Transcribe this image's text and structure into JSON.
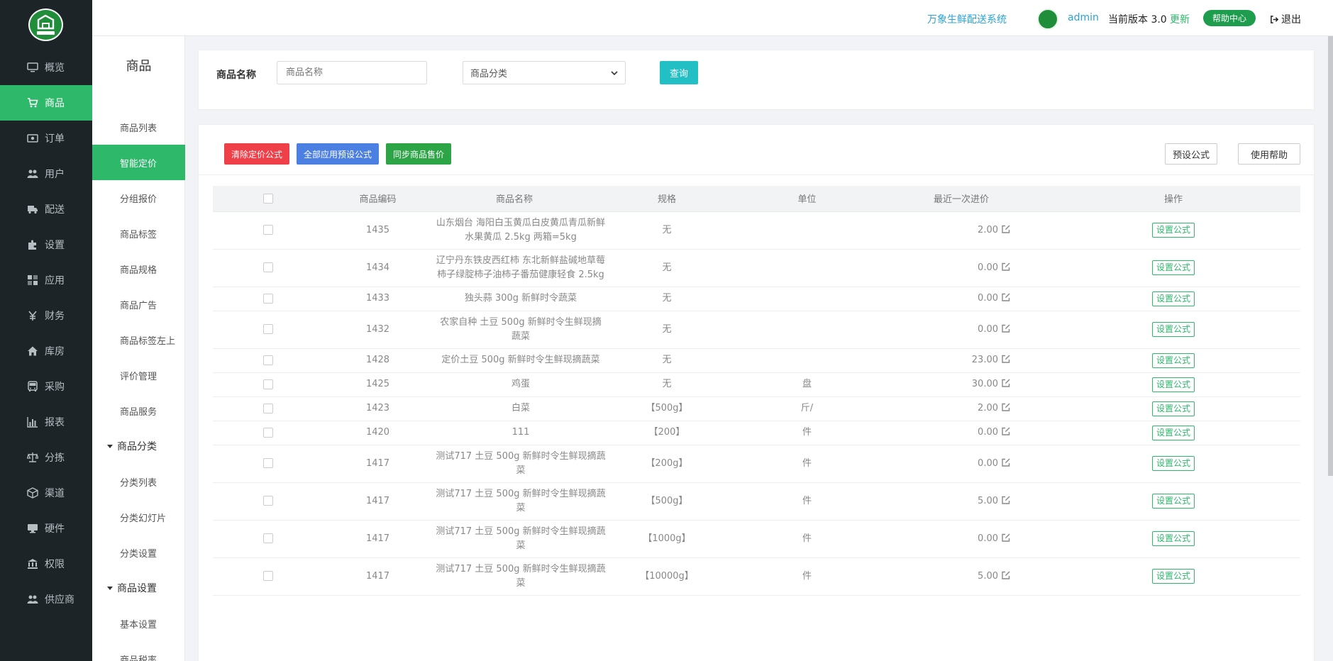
{
  "sidebar": {
    "items": [
      {
        "label": "概览",
        "icon": "monitor-icon"
      },
      {
        "label": "商品",
        "icon": "cart-icon",
        "active": true
      },
      {
        "label": "订单",
        "icon": "money-icon"
      },
      {
        "label": "用户",
        "icon": "users-icon"
      },
      {
        "label": "配送",
        "icon": "truck-icon"
      },
      {
        "label": "设置",
        "icon": "puzzle-icon"
      },
      {
        "label": "应用",
        "icon": "apps-icon"
      },
      {
        "label": "财务",
        "icon": "yen-icon"
      },
      {
        "label": "库房",
        "icon": "home-icon"
      },
      {
        "label": "采购",
        "icon": "bus-icon"
      },
      {
        "label": "报表",
        "icon": "bar-chart-icon"
      },
      {
        "label": "分拣",
        "icon": "scale-icon"
      },
      {
        "label": "渠道",
        "icon": "cube-icon"
      },
      {
        "label": "硬件",
        "icon": "desktop-icon"
      },
      {
        "label": "权限",
        "icon": "bank-icon"
      },
      {
        "label": "供应商",
        "icon": "users-icon"
      }
    ]
  },
  "topbar": {
    "system_name": "万象生鲜配送系统",
    "user": "admin",
    "version_label": "当前版本",
    "version": "3.0",
    "update_label": "更新",
    "help_label": "帮助中心",
    "logout_label": "退出"
  },
  "subnav": {
    "title": "商品",
    "items": [
      {
        "label": "商品列表",
        "type": "item"
      },
      {
        "label": "智能定价",
        "type": "item",
        "active": true
      },
      {
        "label": "分组报价",
        "type": "item"
      },
      {
        "label": "商品标签",
        "type": "item"
      },
      {
        "label": "商品规格",
        "type": "item"
      },
      {
        "label": "商品广告",
        "type": "item"
      },
      {
        "label": "商品标签左上",
        "type": "item"
      },
      {
        "label": "评价管理",
        "type": "item"
      },
      {
        "label": "商品服务",
        "type": "item"
      },
      {
        "label": "商品分类",
        "type": "group"
      },
      {
        "label": "分类列表",
        "type": "item"
      },
      {
        "label": "分类幻灯片",
        "type": "item"
      },
      {
        "label": "分类设置",
        "type": "item"
      },
      {
        "label": "商品设置",
        "type": "group"
      },
      {
        "label": "基本设置",
        "type": "item"
      },
      {
        "label": "商品税率",
        "type": "item"
      }
    ]
  },
  "search": {
    "name_label": "商品名称",
    "name_placeholder": "商品名称",
    "category_placeholder": "商品分类",
    "query_label": "查询"
  },
  "actions": {
    "clear_formula": "清除定价公式",
    "apply_all_preset": "全部应用预设公式",
    "sync_price": "同步商品售价",
    "preset_formula": "预设公式",
    "usage_help": "使用帮助"
  },
  "table": {
    "columns": [
      "商品编码",
      "商品名称",
      "规格",
      "单位",
      "最近一次进价",
      "操作"
    ],
    "action_label": "设置公式",
    "rows": [
      {
        "code": "1435",
        "name": "山东烟台 海阳白玉黄瓜白皮黄瓜青瓜新鲜水果黄瓜 2.5kg 两箱=5kg",
        "spec": "无",
        "unit": "",
        "price": "2.00"
      },
      {
        "code": "1434",
        "name": "辽宁丹东铁皮西红柿 东北新鲜盐碱地草莓柿子绿腚柿子油柿子番茄健康轻食 2.5kg",
        "spec": "无",
        "unit": "",
        "price": "0.00"
      },
      {
        "code": "1433",
        "name": "独头蒜 300g 新鲜时令蔬菜",
        "spec": "无",
        "unit": "",
        "price": "0.00"
      },
      {
        "code": "1432",
        "name": "农家自种 土豆 500g 新鲜时令生鲜现摘蔬菜",
        "spec": "无",
        "unit": "",
        "price": "0.00"
      },
      {
        "code": "1428",
        "name": "定价土豆 500g 新鲜时令生鲜现摘蔬菜",
        "spec": "无",
        "unit": "",
        "price": "23.00"
      },
      {
        "code": "1425",
        "name": "鸡蛋",
        "spec": "无",
        "unit": "盘",
        "price": "30.00"
      },
      {
        "code": "1423",
        "name": "白菜",
        "spec": "【500g】",
        "unit": "斤/",
        "price": "2.00"
      },
      {
        "code": "1420",
        "name": "111",
        "spec": "【200】",
        "unit": "件",
        "price": "0.00"
      },
      {
        "code": "1417",
        "name": "测试717 土豆 500g 新鲜时令生鲜现摘蔬菜",
        "spec": "【200g】",
        "unit": "件",
        "price": "0.00"
      },
      {
        "code": "1417",
        "name": "测试717 土豆 500g 新鲜时令生鲜现摘蔬菜",
        "spec": "【500g】",
        "unit": "件",
        "price": "5.00"
      },
      {
        "code": "1417",
        "name": "测试717 土豆 500g 新鲜时令生鲜现摘蔬菜",
        "spec": "【1000g】",
        "unit": "件",
        "price": "0.00"
      },
      {
        "code": "1417",
        "name": "测试717 土豆 500g 新鲜时令生鲜现摘蔬菜",
        "spec": "【10000g】",
        "unit": "件",
        "price": "5.00"
      }
    ]
  },
  "colors": {
    "sidebar_bg": "#1d2427",
    "accent_green": "#2db86a",
    "query_teal": "#22bfc4",
    "danger_red": "#ef3f48",
    "primary_blue": "#4c7fe2",
    "link_blue": "#2ba3d8"
  }
}
